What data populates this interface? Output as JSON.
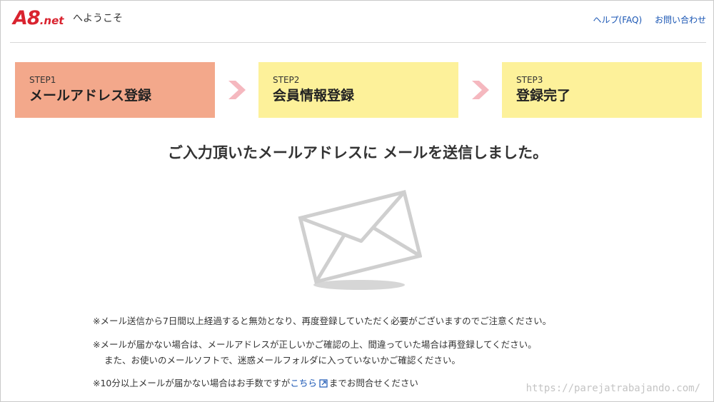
{
  "header": {
    "logo_main": "A8",
    "logo_suffix": ".net",
    "welcome": "へようこそ",
    "help_link": "ヘルプ(FAQ)",
    "contact_link": "お問い合わせ"
  },
  "steps": [
    {
      "num": "STEP1",
      "label": "メールアドレス登録",
      "active": true
    },
    {
      "num": "STEP2",
      "label": "会員情報登録",
      "active": false
    },
    {
      "num": "STEP3",
      "label": "登録完了",
      "active": false
    }
  ],
  "main": {
    "headline": "ご入力頂いたメールアドレスに メールを送信しました。"
  },
  "notes": {
    "note1": "※メール送信から7日間以上経過すると無効となり、再度登録していただく必要がございますのでご注意ください。",
    "note2_line1": "※メールが届かない場合は、メールアドレスが正しいかご確認の上、間違っていた場合は再登録してください。",
    "note2_line2": "また、お使いのメールソフトで、迷惑メールフォルダに入っていないかご確認ください。",
    "note3_prefix": "※10分以上メールが届かない場合はお手数ですが",
    "note3_link": "こちら",
    "note3_suffix": "までお問合せください"
  },
  "watermark": "https://parejatrabajando.com/",
  "colors": {
    "brand_red": "#d9232f",
    "step_active": "#f3a88b",
    "step_inactive": "#fdf19a",
    "chevron": "#f5b8bf",
    "link": "#1a56b4"
  },
  "icons": {
    "chevron": "chevron-right-icon",
    "envelope": "envelope-icon",
    "external_link": "external-link-icon"
  }
}
